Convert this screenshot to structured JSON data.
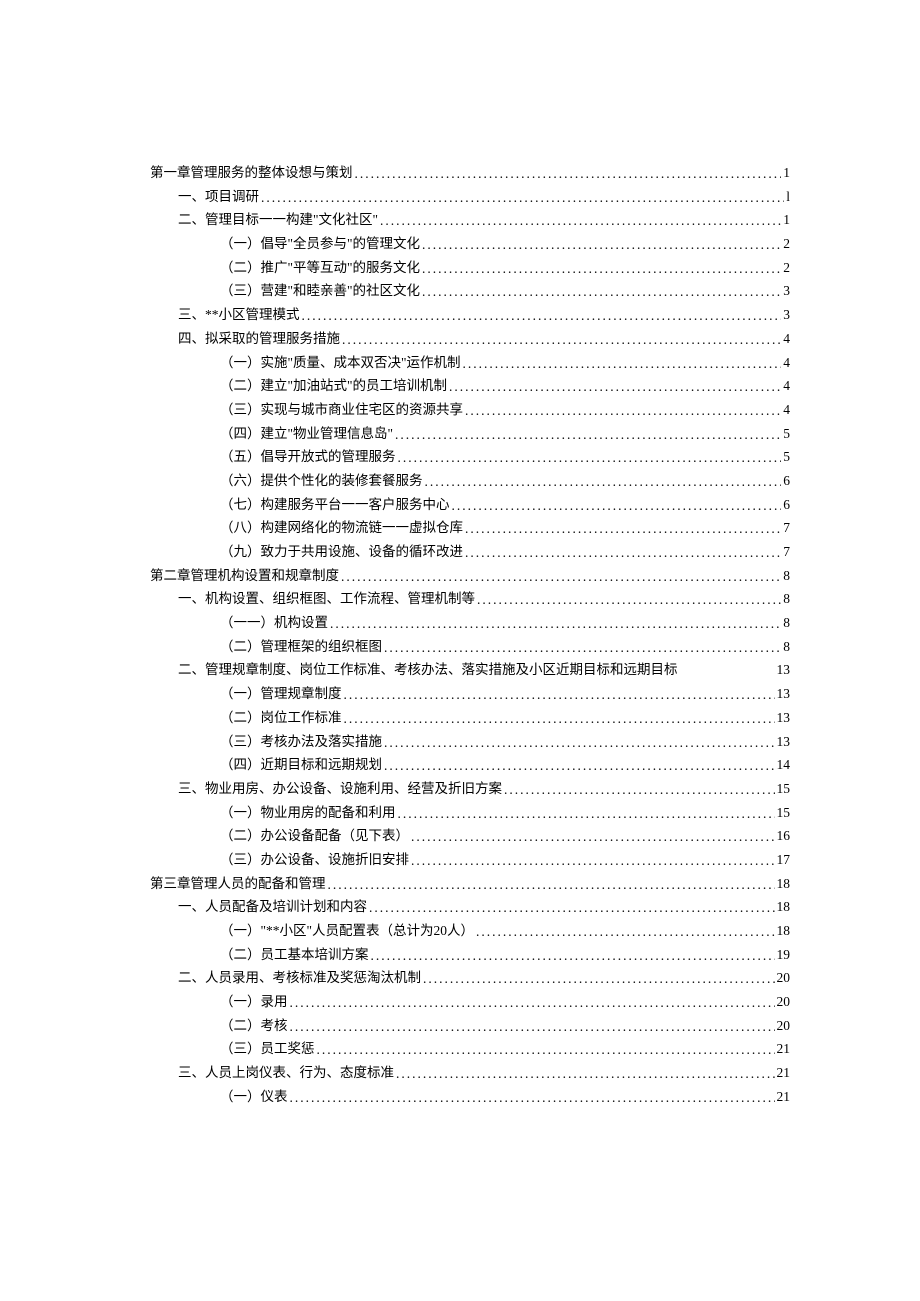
{
  "toc": [
    {
      "level": 0,
      "title": "第一章管理服务的整体设想与策划",
      "page": "1"
    },
    {
      "level": 1,
      "title": "一、项目调研",
      "page": "l"
    },
    {
      "level": 1,
      "title": "二、管理目标一一构建\"文化社区\"",
      "page": "1"
    },
    {
      "level": 2,
      "title": "（一）倡导\"全员参与\"的管理文化",
      "page": "2"
    },
    {
      "level": 2,
      "title": "（二）推广\"平等互动\"的服务文化",
      "page": "2"
    },
    {
      "level": 2,
      "title": "（三）营建\"和睦亲善\"的社区文化",
      "page": "3"
    },
    {
      "level": 1,
      "title": "三、**小区管理模式",
      "page": "3"
    },
    {
      "level": 1,
      "title": "四、拟采取的管理服务措施",
      "page": "4"
    },
    {
      "level": 2,
      "title": "（一）实施\"质量、成本双否决\"运作机制",
      "page": "4"
    },
    {
      "level": 2,
      "title": "（二）建立\"加油站式\"的员工培训机制",
      "page": "4"
    },
    {
      "level": 2,
      "title": "（三）实现与城市商业住宅区的资源共享",
      "page": "4"
    },
    {
      "level": 2,
      "title": "（四）建立\"物业管理信息岛\"",
      "page": "5"
    },
    {
      "level": 2,
      "title": "（五）倡导开放式的管理服务",
      "page": "5"
    },
    {
      "level": 2,
      "title": "（六）提供个性化的装修套餐服务",
      "page": "6"
    },
    {
      "level": 2,
      "title": "（七）构建服务平台一一客户服务中心",
      "page": "6"
    },
    {
      "level": 2,
      "title": "（八）构建网络化的物流链一一虚拟仓库",
      "page": "7"
    },
    {
      "level": 2,
      "title": "（九）致力于共用设施、设备的循环改进",
      "page": "7"
    },
    {
      "level": 0,
      "title": "第二章管理机构设置和规章制度",
      "page": "8"
    },
    {
      "level": 1,
      "title": "一、机构设置、组织框图、工作流程、管理机制等",
      "page": "8"
    },
    {
      "level": 2,
      "title": "（一一）机构设置",
      "page": "8"
    },
    {
      "level": 2,
      "title": "（二）管理框架的组织框图",
      "page": "8"
    },
    {
      "level": 1,
      "title": "二、管理规章制度、岗位工作标准、考核办法、落实措施及小区近期目标和远期目标",
      "page": "13",
      "noLeader": true
    },
    {
      "level": 2,
      "title": "（一）管理规章制度",
      "page": "13"
    },
    {
      "level": 2,
      "title": "（二）岗位工作标准",
      "page": "13"
    },
    {
      "level": 2,
      "title": "（三）考核办法及落实措施",
      "page": "13"
    },
    {
      "level": 2,
      "title": "（四）近期目标和远期规划",
      "page": "14"
    },
    {
      "level": 1,
      "title": "三、物业用房、办公设备、设施利用、经营及折旧方案",
      "page": "15"
    },
    {
      "level": 2,
      "title": "（一）物业用房的配备和利用",
      "page": "15"
    },
    {
      "level": 2,
      "title": "（二）办公设备配备（见下表）",
      "page": "16"
    },
    {
      "level": 2,
      "title": "（三）办公设备、设施折旧安排",
      "page": "17"
    },
    {
      "level": 0,
      "title": "第三章管理人员的配备和管理",
      "page": "18"
    },
    {
      "level": 1,
      "title": "一、人员配备及培训计划和内容",
      "page": "18"
    },
    {
      "level": 2,
      "title": "（一）\"**小区\"人员配置表（总计为20人）",
      "page": "18"
    },
    {
      "level": 2,
      "title": "（二）员工基本培训方案",
      "page": "19"
    },
    {
      "level": 1,
      "title": "二、人员录用、考核标准及奖惩淘汰机制",
      "page": "20"
    },
    {
      "level": 2,
      "title": "（一）录用",
      "page": "20"
    },
    {
      "level": 2,
      "title": "（二）考核",
      "page": "20"
    },
    {
      "level": 2,
      "title": "（三）员工奖惩",
      "page": "21"
    },
    {
      "level": 1,
      "title": "三、人员上岗仪表、行为、态度标准",
      "page": "21"
    },
    {
      "level": 2,
      "title": "（一）仪表",
      "page": "21"
    }
  ]
}
